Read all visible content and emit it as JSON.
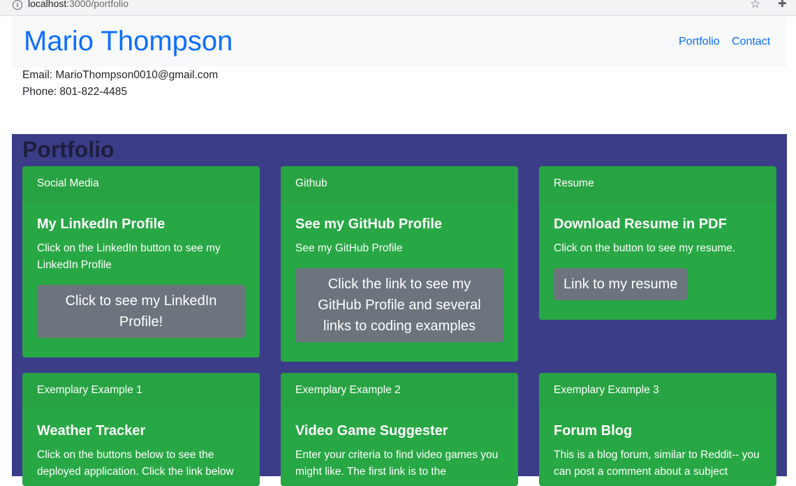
{
  "browser": {
    "info_icon": "i",
    "url_host": "localhost",
    "url_path": ":3000/portfolio",
    "star_icon": "☆",
    "extensions_icon": "✚"
  },
  "header": {
    "site_name": "Mario Thompson",
    "nav": [
      "Portfolio",
      "Contact"
    ]
  },
  "contact": {
    "email": "Email: MarioThompson0010@gmail.com",
    "phone": "Phone: 801-822-4485"
  },
  "portfolio": {
    "heading": "Portfolio",
    "cards": [
      {
        "header": "Social Media",
        "title": "My LinkedIn Profile",
        "text": "Click on the LinkedIn button to see my LinkedIn Profile",
        "button": "Click to see my LinkedIn Profile!"
      },
      {
        "header": "Github",
        "title": "See my GitHub Profile",
        "text": "See my GitHub Profile",
        "button": "Click the link to see my GitHub Profile and several links to coding examples"
      },
      {
        "header": "Resume",
        "title": "Download Resume in PDF",
        "text": "Click on the button to see my resume.",
        "button": "Link to my resume"
      },
      {
        "header": "Exemplary Example 1",
        "title": "Weather Tracker",
        "text": "Click on the buttons below to see the deployed application. Click the link below"
      },
      {
        "header": "Exemplary Example 2",
        "title": "Video Game Suggester",
        "text": "Enter your criteria to find video games you might like. The first link is to the"
      },
      {
        "header": "Exemplary Example 3",
        "title": "Forum Blog",
        "text": "This is a blog forum, similar to Reddit-- you can post a comment about a subject"
      }
    ]
  },
  "colors": {
    "brand_blue": "#0d6efd",
    "section_bg": "#3b3d89",
    "card_green": "#28a745",
    "button_gray": "#6c757d"
  }
}
